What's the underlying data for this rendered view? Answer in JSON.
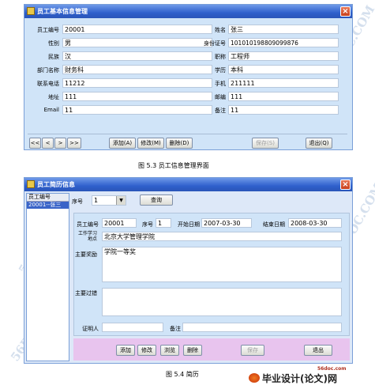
{
  "window1": {
    "title": "员工基本信息管理",
    "fields": [
      {
        "label": "员工编号",
        "value": "20001"
      },
      {
        "label": "姓名",
        "value": "张三"
      },
      {
        "label": "性别",
        "value": "男"
      },
      {
        "label": "身份证号",
        "value": "101010198809099876"
      },
      {
        "label": "民族",
        "value": "汉"
      },
      {
        "label": "职称",
        "value": "工程师"
      },
      {
        "label": "部门名称",
        "value": "财务科"
      },
      {
        "label": "学历",
        "value": "本科"
      },
      {
        "label": "联系电话",
        "value": "11212"
      },
      {
        "label": "手机",
        "value": "211111"
      },
      {
        "label": "地址",
        "value": "111"
      },
      {
        "label": "邮编",
        "value": "111"
      },
      {
        "label": "Email",
        "value": "11"
      },
      {
        "label": "备注",
        "value": "11"
      }
    ],
    "nav": [
      "<<",
      "<",
      ">",
      ">>"
    ],
    "buttons": {
      "add": "添加(A)",
      "edit": "修改(M)",
      "delete": "删除(D)",
      "save": "保存(S)",
      "exit": "退出(Q)"
    }
  },
  "caption1": "图 5.3  员工信息管理界面",
  "window2": {
    "title": "员工简历信息",
    "list_header": "员工编号",
    "list_items": [
      "20001--张三"
    ],
    "seq_label": "序号",
    "seq_value": "1",
    "query_label": "查询",
    "fields": {
      "emp_id_label": "员工编号",
      "emp_id": "20001",
      "seq_label": "序号",
      "seq": "1",
      "start_label": "开始日期",
      "start": "2007-03-30",
      "end_label": "结束日期",
      "end": "2008-03-30",
      "workplace_label": "工作学习地点",
      "workplace": "北京大学管理学院",
      "award_label": "主要奖励",
      "award": "学院一等奖",
      "fault_label": "主要过错",
      "fault": "",
      "witness_label": "证明人",
      "witness": "",
      "remark_label": "备注",
      "remark": ""
    },
    "buttons": {
      "add": "添加",
      "edit": "修改",
      "browse": "浏览",
      "delete": "删除",
      "save": "保存",
      "exit": "退出"
    }
  },
  "caption2": "图 5.4  简历",
  "watermark": "56DOC.COM",
  "brand": {
    "site": "56doc.com",
    "name": "毕业设计(论文)网"
  }
}
